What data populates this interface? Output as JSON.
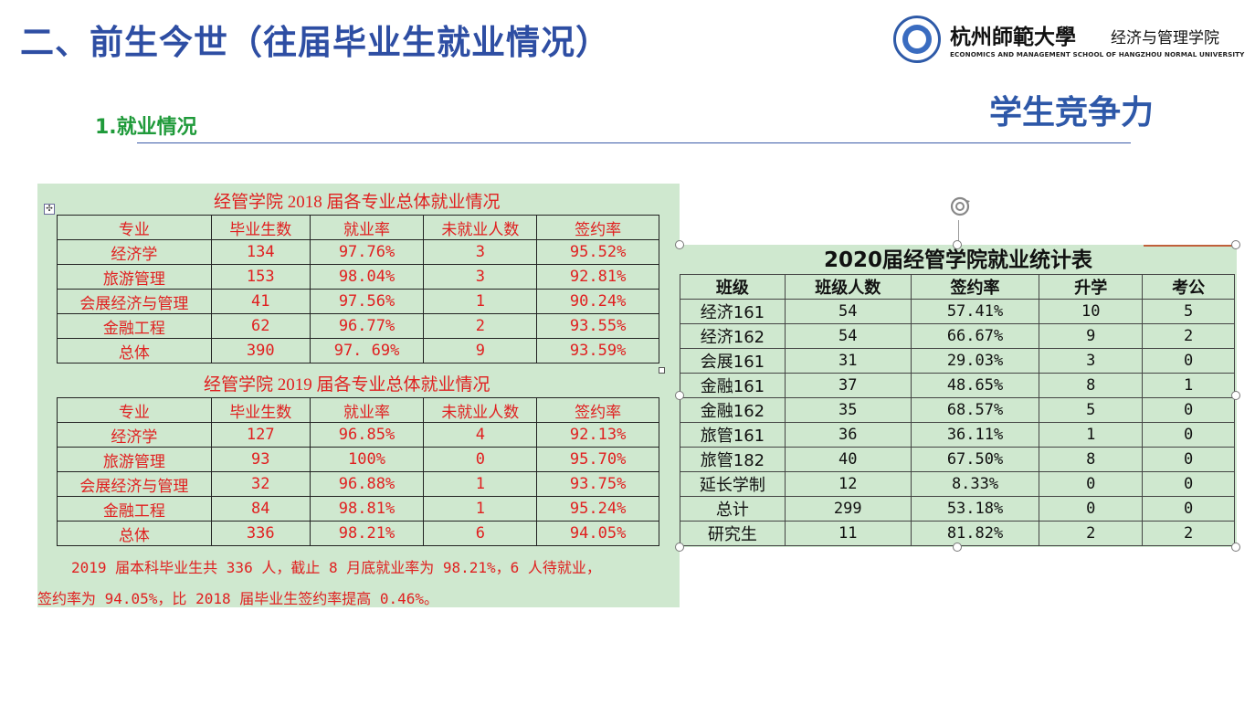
{
  "header": {
    "title": "二、前生今世（往届毕业生就业情况）",
    "logo_name": "杭州師範大學",
    "logo_dept": "经济与管理学院",
    "logo_en": "ECONOMICS AND MANAGEMENT SCHOOL OF HANGZHOU NORMAL UNIVERSITY",
    "badge": "学生竞争力",
    "subheading": "1.就业情况"
  },
  "table2018": {
    "caption": "经管学院 2018 届各专业总体就业情况",
    "headers": [
      "专业",
      "毕业生数",
      "就业率",
      "未就业人数",
      "签约率"
    ],
    "rows": [
      [
        "经济学",
        "134",
        "97.76%",
        "3",
        "95.52%"
      ],
      [
        "旅游管理",
        "153",
        "98.04%",
        "3",
        "92.81%"
      ],
      [
        "会展经济与管理",
        "41",
        "97.56%",
        "1",
        "90.24%"
      ],
      [
        "金融工程",
        "62",
        "96.77%",
        "2",
        "93.55%"
      ],
      [
        "总体",
        "390",
        "97. 69%",
        "9",
        "93.59%"
      ]
    ]
  },
  "table2019": {
    "caption": "经管学院 2019 届各专业总体就业情况",
    "headers": [
      "专业",
      "毕业生数",
      "就业率",
      "未就业人数",
      "签约率"
    ],
    "rows": [
      [
        "经济学",
        "127",
        "96.85%",
        "4",
        "92.13%"
      ],
      [
        "旅游管理",
        "93",
        "100%",
        "0",
        "95.70%"
      ],
      [
        "会展经济与管理",
        "32",
        "96.88%",
        "1",
        "93.75%"
      ],
      [
        "金融工程",
        "84",
        "98.81%",
        "1",
        "95.24%"
      ],
      [
        "总体",
        "336",
        "98.21%",
        "6",
        "94.05%"
      ]
    ]
  },
  "summary": {
    "line1": "2019 届本科毕业生共 336 人，截止 8 月底就业率为 98.21%，6 人待就业，",
    "line2": "签约率为 94.05%，比 2018 届毕业生签约率提高 0.46%。"
  },
  "table2020": {
    "title": "2020届经管学院就业统计表",
    "headers": [
      "班级",
      "班级人数",
      "签约率",
      "升学",
      "考公"
    ],
    "rows": [
      [
        "经济161",
        "54",
        "57.41%",
        "10",
        "5"
      ],
      [
        "经济162",
        "54",
        "66.67%",
        "9",
        "2"
      ],
      [
        "会展161",
        "31",
        "29.03%",
        "3",
        "0"
      ],
      [
        "金融161",
        "37",
        "48.65%",
        "8",
        "1"
      ],
      [
        "金融162",
        "35",
        "68.57%",
        "5",
        "0"
      ],
      [
        "旅管161",
        "36",
        "36.11%",
        "1",
        "0"
      ],
      [
        "旅管182",
        "40",
        "67.50%",
        "8",
        "0"
      ],
      [
        "延长学制",
        "12",
        "8.33%",
        "0",
        "0"
      ],
      [
        "总计",
        "299",
        "53.18%",
        "0",
        "0"
      ],
      [
        "研究生",
        "11",
        "81.82%",
        "2",
        "2"
      ]
    ]
  }
}
